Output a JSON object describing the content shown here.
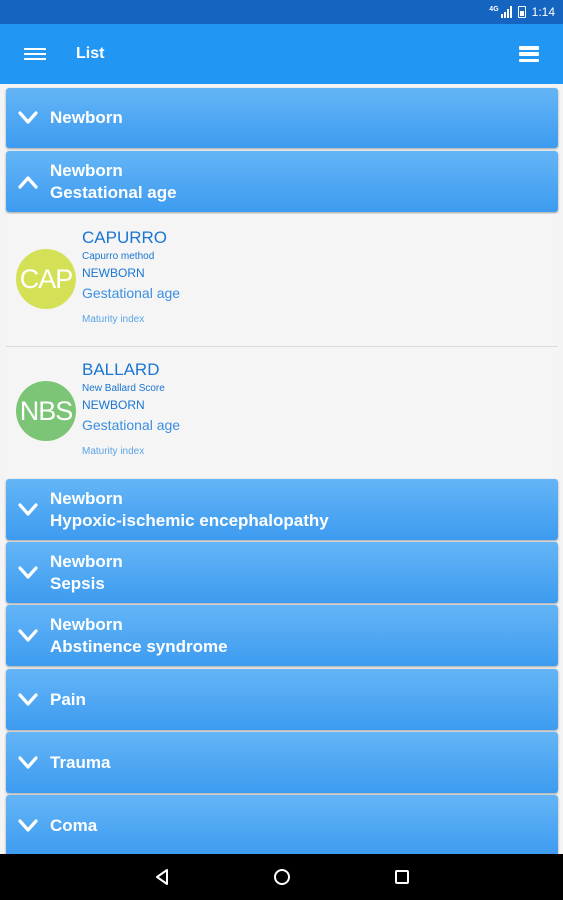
{
  "status_bar": {
    "network": "4G",
    "time": "1:14"
  },
  "app_bar": {
    "title": "List"
  },
  "groups_top": [
    {
      "line1": "Newborn",
      "line2": ""
    },
    {
      "line1": "Newborn",
      "line2": "Gestational age",
      "expanded": true
    }
  ],
  "items": [
    {
      "abbr": "CAP",
      "name": "CAPURRO",
      "subtitle": "Capurro method",
      "category": "NEWBORN",
      "tag": "Gestational age",
      "index_type": "Maturity index",
      "avatar_color": "#cddc39"
    },
    {
      "abbr": "NBS",
      "name": "BALLARD",
      "subtitle": "New Ballard Score",
      "category": "NEWBORN",
      "tag": "Gestational age",
      "index_type": "Maturity index",
      "avatar_color": "#66bb6a"
    }
  ],
  "groups_bottom": [
    {
      "line1": "Newborn",
      "line2": "Hypoxic-ischemic encephalopathy"
    },
    {
      "line1": "Newborn",
      "line2": "Sepsis"
    },
    {
      "line1": "Newborn",
      "line2": "Abstinence syndrome"
    },
    {
      "line1": "Pain",
      "line2": ""
    },
    {
      "line1": "Trauma",
      "line2": ""
    },
    {
      "line1": "Coma",
      "line2": ""
    }
  ],
  "colors": {
    "primary": "#2196f3",
    "primary_dark": "#1565c0",
    "group": "#4aa6f2",
    "link_text": "#1976d2"
  }
}
